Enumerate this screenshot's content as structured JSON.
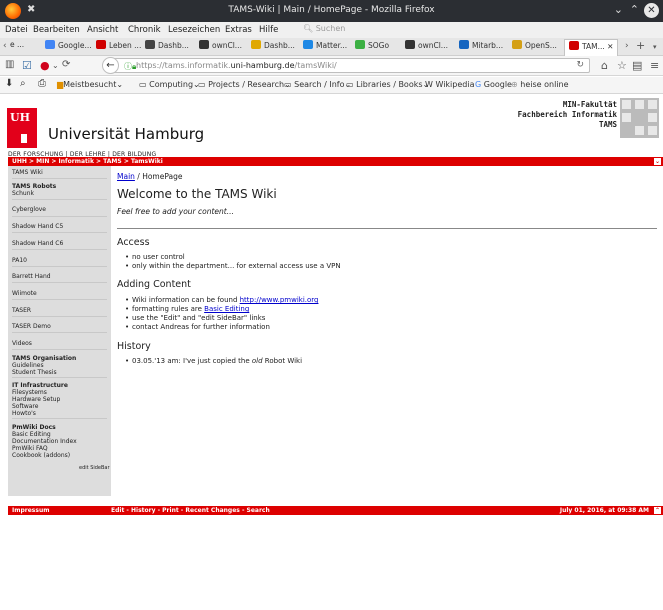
{
  "window": {
    "title": "TAMS-Wiki | Main / HomePage - Mozilla Firefox"
  },
  "menu": {
    "items": [
      "Datei",
      "Bearbeiten",
      "Ansicht",
      "Chronik",
      "Lesezeichen",
      "Extras",
      "Hilfe"
    ],
    "search_placeholder": "Suchen"
  },
  "tabs": [
    {
      "label": "e ...",
      "color": "#888888"
    },
    {
      "label": "Google...",
      "color": "#4285f4"
    },
    {
      "label": "Leben ...",
      "color": "#d00000"
    },
    {
      "label": "Dashb...",
      "color": "#444444"
    },
    {
      "label": "ownCl...",
      "color": "#333333"
    },
    {
      "label": "Dashb...",
      "color": "#e0a800"
    },
    {
      "label": "Matter...",
      "color": "#1e88e5"
    },
    {
      "label": "SOGo",
      "color": "#3cb043"
    },
    {
      "label": "ownCl...",
      "color": "#333333"
    },
    {
      "label": "Mitarb...",
      "color": "#1565c0"
    },
    {
      "label": "OpenS...",
      "color": "#d4a017"
    },
    {
      "label": "TAM...",
      "color": "#d00000",
      "active": true
    }
  ],
  "nav": {
    "url_prefix": "https://tams.informatik.",
    "url_host": "uni-hamburg.de",
    "url_path": "/tamsWiki/"
  },
  "bookmarks": [
    {
      "label": "Meistbesucht",
      "icon": "folder-icon"
    },
    {
      "label": "Computing",
      "icon": "folder-icon"
    },
    {
      "label": "Projects / Research",
      "icon": "folder-icon"
    },
    {
      "label": "Search / Info",
      "icon": "folder-icon"
    },
    {
      "label": "Libraries / Books",
      "icon": "folder-icon"
    },
    {
      "label": "Wikipedia",
      "icon": "wikipedia-icon"
    },
    {
      "label": "Google",
      "icon": "google-icon"
    },
    {
      "label": "heise online",
      "icon": "heise-icon"
    }
  ],
  "header": {
    "logo_text": "UH",
    "university": "Universität Hamburg",
    "tagline": "DER FORSCHUNG | DER LEHRE | DER BILDUNG",
    "faculty_line1": "MIN-Fakultät",
    "faculty_line2": "Fachbereich Informatik",
    "faculty_line3": "TAMS",
    "breadcrumb": "UHH > MIN > Informatik > TAMS > TamsWiki"
  },
  "sidebar": {
    "tams_wiki": "TAMS Wiki",
    "tams_robots": "TAMS Robots",
    "schunk": "Schunk",
    "cyberglove": "Cyberglove",
    "shadow_c5": "Shadow Hand C5",
    "shadow_c6": "Shadow Hand C6",
    "pa10": "PA10",
    "barrett": "Barrett Hand",
    "wiimote": "Wiimote",
    "taser": "TASER",
    "taser_demo": "TASER Demo",
    "videos": "Videos",
    "organisation": "TAMS Organisation",
    "guidelines": "Guidelines",
    "student_thesis": "Student Thesis",
    "it_infra": "IT Infrastructure",
    "filesystems": "Filesystems",
    "hardware_setup": "Hardware Setup",
    "software": "Software",
    "howtos": "Howto's",
    "pmwiki_docs": "PmWiki Docs",
    "basic_editing": "Basic Editing",
    "doc_index": "Documentation Index",
    "pmwiki_faq": "PmWiki FAQ",
    "cookbook": "Cookbook (addons)",
    "edit_sidebar": "edit SideBar"
  },
  "content": {
    "crumb_link": "Main",
    "crumb_rest": " / HomePage",
    "title": "Welcome to the TAMS Wiki",
    "intro": "Feel free to add your content...",
    "access_heading": "Access",
    "access_1": "no user control",
    "access_2": "only within the department... for external access use a VPN",
    "adding_heading": "Adding Content",
    "adding_1_pre": "Wiki information can be found ",
    "adding_1_link": "http://www.pmwiki.org",
    "adding_2_pre": "formatting rules are ",
    "adding_2_link": "Basic Editing",
    "adding_3": "use the \"Edit\" and \"edit SideBar\" links",
    "adding_4": "contact Andreas for further information",
    "history_heading": "History",
    "history_1_pre": "03.05.'13 am: I've just copied the ",
    "history_1_em": "old",
    "history_1_post": " Robot Wiki"
  },
  "footer": {
    "impressum": "Impressum",
    "actions": "Edit - History - Print - Recent Changes - Search",
    "date": "July 01, 2016, at 09:38 AM"
  }
}
